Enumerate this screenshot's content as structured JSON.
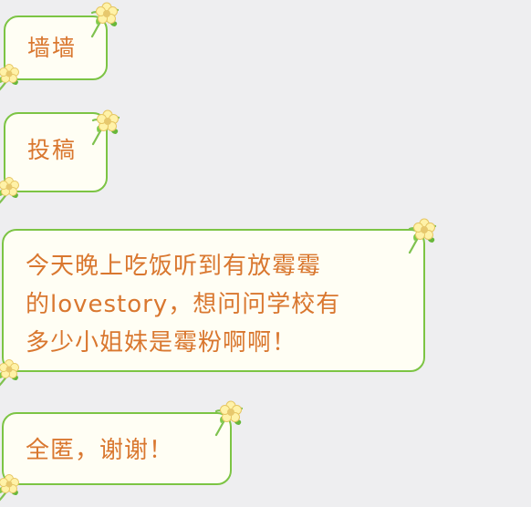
{
  "messages": [
    {
      "text": "墙墙"
    },
    {
      "text": "投稿"
    },
    {
      "text": "今天晚上吃饭听到有放霉霉\n的lovestory，想问问学校有\n多少小姐妹是霉粉啊啊！"
    },
    {
      "text": "全匿，谢谢！"
    }
  ],
  "decor": {
    "bubble_theme": "flower-vine",
    "accent_colors": {
      "text": "#d9772f",
      "border": "#7cc444",
      "background": "#eeeef0"
    }
  }
}
